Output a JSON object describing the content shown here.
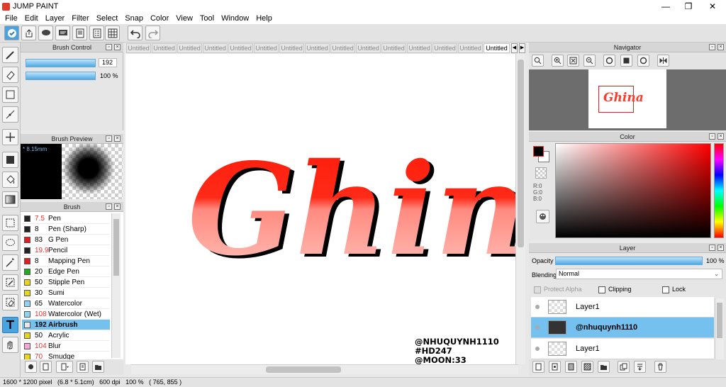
{
  "window": {
    "title": "JUMP PAINT",
    "minimize": "—",
    "maximize": "❐",
    "close": "✕"
  },
  "menu": [
    "File",
    "Edit",
    "Layer",
    "Filter",
    "Select",
    "Snap",
    "Color",
    "View",
    "Tool",
    "Window",
    "Help"
  ],
  "brush_control": {
    "title": "Brush Control",
    "size_value": "192",
    "opacity_value": "100 %",
    "size_fraction": 1.0,
    "opacity_fraction": 1.0
  },
  "brush_preview": {
    "title": "Brush Preview",
    "size_label": "* 8.15mm"
  },
  "brush_panel": {
    "title": "Brush",
    "items": [
      {
        "size": "7.5",
        "name": "Pen",
        "color": "#222222"
      },
      {
        "size": "8",
        "name": "Pen (Sharp)",
        "color": "#222222"
      },
      {
        "size": "83",
        "name": "G Pen",
        "color": "#e02020"
      },
      {
        "size": "19.9",
        "name": "Pencil",
        "color": "#222222"
      },
      {
        "size": "8",
        "name": "Mapping Pen",
        "color": "#e02020"
      },
      {
        "size": "20",
        "name": "Edge Pen",
        "color": "#22aa22"
      },
      {
        "size": "50",
        "name": "Stipple Pen",
        "color": "#e8d420"
      },
      {
        "size": "30",
        "name": "Sumi",
        "color": "#e8d420"
      },
      {
        "size": "65",
        "name": "Watercolor",
        "color": "#8dd4f0"
      },
      {
        "size": "108",
        "name": "Watercolor (Wet)",
        "color": "#8dd4f0"
      },
      {
        "size": "192",
        "name": "Airbrush",
        "color": "#e8e8e8",
        "selected": true
      },
      {
        "size": "50",
        "name": "Acrylic",
        "color": "#e8d420"
      },
      {
        "size": "104",
        "name": "Blur",
        "color": "#f5a8d8"
      },
      {
        "size": "70",
        "name": "Smudge",
        "color": "#e8d420"
      }
    ]
  },
  "tabs": [
    "Untitled",
    "Untitled",
    "Untitled",
    "Untitled",
    "Untitled",
    "Untitled",
    "Untitled",
    "Untitled",
    "Untitled",
    "Untitled",
    "Untitled",
    "Untitled",
    "Untitled",
    "Untitled",
    "Untitled"
  ],
  "canvas": {
    "artwork_text": "Ghina",
    "watermark_lines": [
      "@NHUQUYNH1110",
      "#HD247",
      "@MOON:33"
    ]
  },
  "navigator": {
    "title": "Navigator",
    "thumb_text": "Ghina"
  },
  "color_panel": {
    "title": "Color",
    "r": "R:0",
    "g": "G:0",
    "b": "B:0",
    "hue_color": "#ff0000",
    "fg_color": "#000000",
    "bg_color": "#ffffff"
  },
  "layer_panel": {
    "title": "Layer",
    "opacity_label": "Opacity",
    "opacity_value": "100 %",
    "blending_label": "Blending",
    "blending_value": "Normal",
    "protect_alpha": "Protect Alpha",
    "clipping": "Clipping",
    "lock": "Lock",
    "layers": [
      {
        "name": "Layer1"
      },
      {
        "name": "@nhuquynh1110",
        "selected": true
      },
      {
        "name": "Layer1"
      }
    ]
  },
  "status": {
    "text": "1600 * 1200 pixel   (6.8 * 5.1cm)   600 dpi   100 %   ( 765, 855 )"
  }
}
